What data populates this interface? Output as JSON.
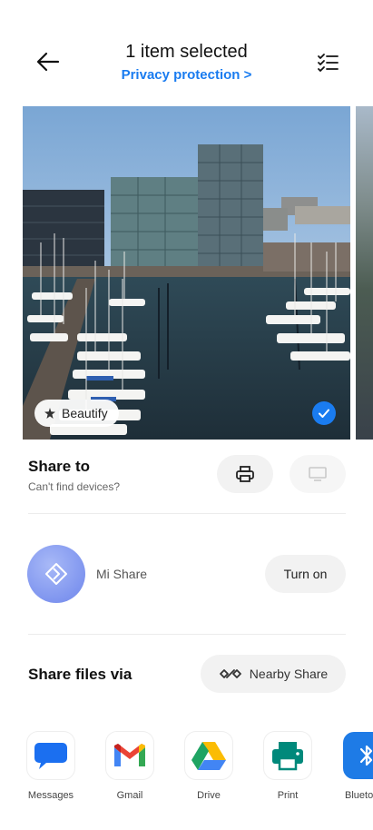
{
  "header": {
    "title": "1 item selected",
    "subtitle": "Privacy protection >"
  },
  "preview": {
    "beautify_label": "Beautify",
    "selected": true
  },
  "share_to": {
    "title": "Share to",
    "subtitle": "Can't find devices?"
  },
  "mi_share": {
    "label": "Mi Share",
    "button": "Turn on"
  },
  "share_via": {
    "title": "Share files via",
    "nearby_button": "Nearby Share"
  },
  "apps": [
    {
      "label": "Messages",
      "icon": "messages-icon"
    },
    {
      "label": "Gmail",
      "icon": "gmail-icon"
    },
    {
      "label": "Drive",
      "icon": "drive-icon"
    },
    {
      "label": "Print",
      "icon": "print-icon"
    },
    {
      "label": "Blueto",
      "icon": "bluetooth-icon"
    }
  ],
  "colors": {
    "accent": "#1a7cf0",
    "mi_share": "#7f95ef"
  }
}
